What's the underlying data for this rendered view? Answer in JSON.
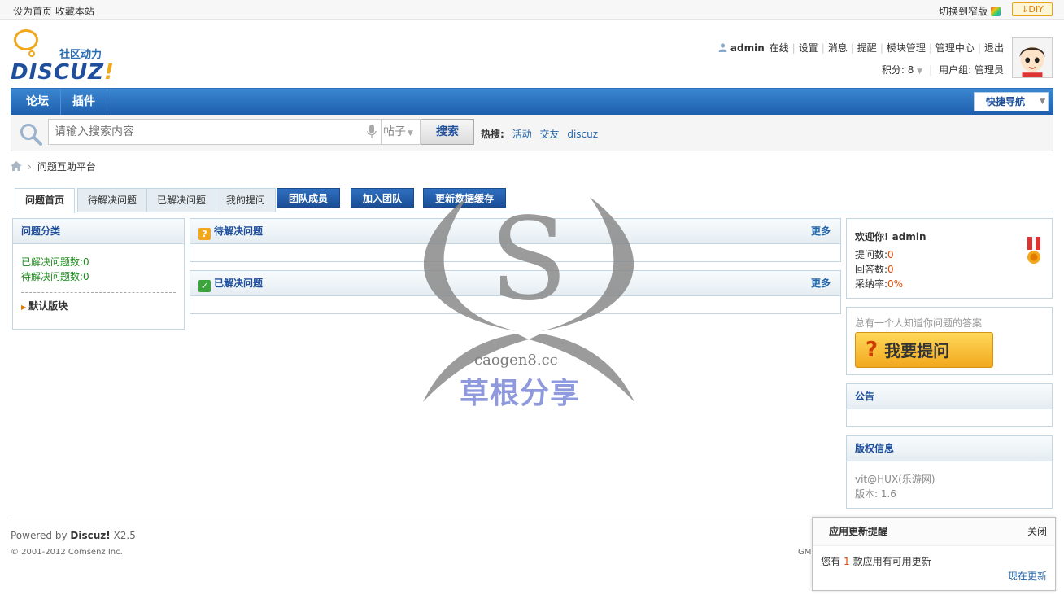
{
  "topbar": {
    "set_home": "设为首页",
    "bookmark": "收藏本站",
    "switch_width": "切换到窄版",
    "diy": "DIY"
  },
  "logo": {
    "tagline": "社区动力",
    "wordmark": "DISCUZ",
    "wordmark_bang": "!"
  },
  "user": {
    "name": "admin",
    "status": "在线",
    "links": [
      "设置",
      "消息",
      "提醒",
      "模块管理",
      "管理中心",
      "退出"
    ],
    "points_label": "积分: 8",
    "group_label": "用户组: 管理员"
  },
  "nav": {
    "items": [
      "论坛",
      "插件"
    ],
    "quick_nav": "快捷导航"
  },
  "search": {
    "placeholder": "请输入搜索内容",
    "type": "帖子",
    "button": "搜索",
    "hot_label": "热搜:",
    "hot_terms": [
      "活动",
      "交友",
      "discuz"
    ]
  },
  "breadcrumb": {
    "current": "问题互助平台"
  },
  "tabs": {
    "items": [
      "问题首页",
      "待解决问题",
      "已解决问题",
      "我的提问"
    ],
    "buttons": [
      "团队成员",
      "加入团队",
      "更新数据缓存"
    ]
  },
  "category": {
    "title": "问题分类",
    "solved": "已解决问题数:0",
    "pending": "待解决问题数:0",
    "board": "默认版块"
  },
  "lists": {
    "pending_title": "待解决问题",
    "solved_title": "已解决问题",
    "more": "更多"
  },
  "welcome": {
    "title": "欢迎你! admin",
    "asked_label": "提问数:",
    "asked_value": "0",
    "answered_label": "回答数:",
    "answered_value": "0",
    "rate_label": "采纳率:",
    "rate_value": "0%"
  },
  "ask": {
    "tip": "总有一个人知道你问题的答案",
    "button": "我要提问"
  },
  "notice_box": {
    "title": "公告"
  },
  "copyright_box": {
    "title": "版权信息",
    "author": "vit@HUX(乐游网)",
    "version": "版本: 1.6"
  },
  "footer": {
    "powered_prefix": "Powered by ",
    "powered_brand": "Discuz!",
    "powered_version": " X2.5",
    "copyright": "© 2001-2012 Comsenz Inc.",
    "gmt": "GMT"
  },
  "update_popup": {
    "title": "应用更新提醒",
    "close": "关闭",
    "msg_prefix": "您有",
    "count": "1",
    "msg_suffix": "款应用有可用更新",
    "action": "现在更新"
  },
  "watermark": {
    "site": "caogen8.cc",
    "name": "草根分享"
  },
  "colors": {
    "brand_blue": "#1f4f9c",
    "nav_blue": "#2a6cb3",
    "accent_orange": "#f2a81d",
    "value_red": "#e04a00",
    "stat_green": "#1c8a1c"
  }
}
